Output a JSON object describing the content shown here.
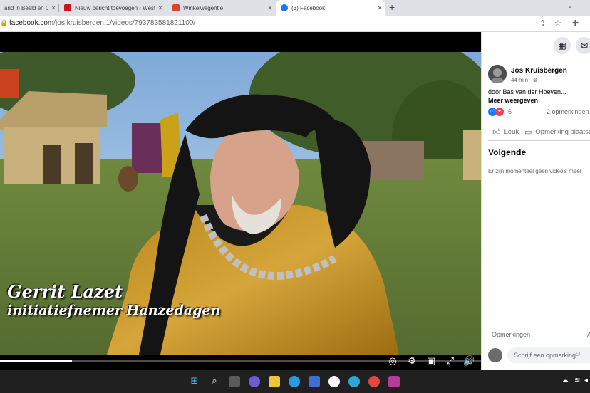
{
  "browser": {
    "tabs": [
      {
        "title": "and in Beeld en Ge",
        "favicon_color": "#3b6ea5",
        "active": false
      },
      {
        "title": "Nieuw bericht toevoegen ‹ West",
        "favicon_color": "#c4161c",
        "active": false
      },
      {
        "title": "Winkelwagentje",
        "favicon_color": "#e4402b",
        "active": false
      },
      {
        "title": "(3) Facebook",
        "favicon_color": "#1877f2",
        "active": true
      }
    ],
    "address": {
      "domain": "facebook.com",
      "path": "/jos.kruisbergen.1/videos/793783581821100/"
    }
  },
  "video": {
    "caption_name": "Gerrit Lazet",
    "caption_role": "initiatiefnemer Hanzedagen",
    "progress": 0.15,
    "controls": [
      "captions-icon",
      "settings-icon",
      "picture-in-picture-icon",
      "fullscreen-icon",
      "volume-icon"
    ]
  },
  "panel": {
    "author": "Jos Kruisbergen",
    "time": "44 min ·",
    "description": "door Bas van der Hoeven...",
    "see_more": "Meer weergeven",
    "reaction_count": "6",
    "comments_count": "2 opmerkingen",
    "like_label": "Leuk",
    "comment_label": "Opmerking plaatsen",
    "up_next_title": "Volgende",
    "up_next_empty": "Er zijn momenteel geen video's meer",
    "comments_header": "Opmerkingen",
    "comments_header_extra": "A",
    "comment_placeholder": "Schrijf een opmerking..."
  },
  "colors": {
    "facebook_blue": "#1877f2",
    "love_red": "#f33e58",
    "taskbar": "#202020"
  }
}
